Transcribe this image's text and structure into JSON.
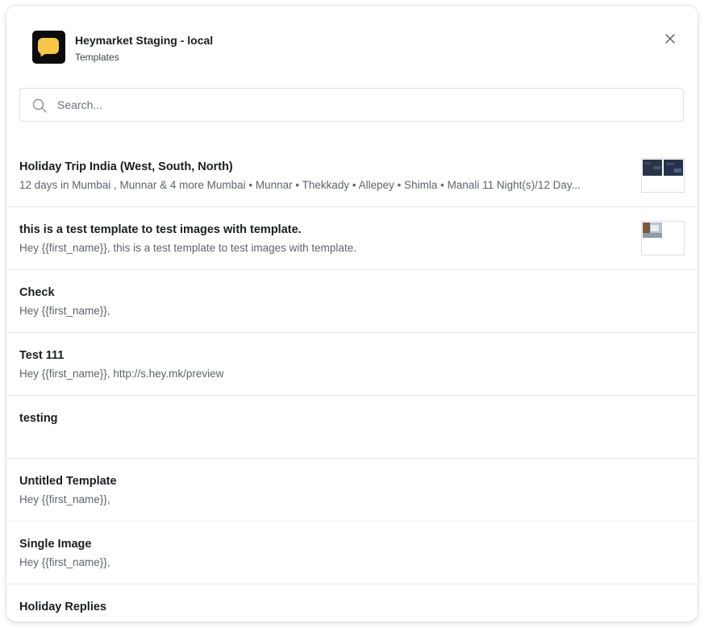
{
  "header": {
    "app_title": "Heymarket Staging - local",
    "subtitle": "Templates",
    "logo_icon": "chat-bubble-logo",
    "close_icon": "close-icon"
  },
  "search": {
    "placeholder": "Search...",
    "value": "",
    "icon": "search-icon"
  },
  "colors": {
    "logo_background": "#0c0c0c",
    "logo_bubble": "#f7c64a",
    "title_text": "#1b1d21",
    "preview_text": "#5f636b",
    "divider": "#e8eaed"
  },
  "templates": [
    {
      "title": "Holiday Trip India (West, South, North)",
      "preview": "12 days in Mumbai , Munnar & 4 more Mumbai • Munnar • Thekkady • Allepey • Shimla • Manali 11 Night(s)/12 Day...",
      "has_thumbnail": true
    },
    {
      "title": "this is a test template to test images with template.",
      "preview": "Hey {{first_name}}, this is a test template to test images with template.",
      "has_thumbnail": true
    },
    {
      "title": "Check",
      "preview": "Hey {{first_name}},",
      "has_thumbnail": false
    },
    {
      "title": "Test 111",
      "preview": "Hey {{first_name}}, http://s.hey.mk/preview",
      "has_thumbnail": false
    },
    {
      "title": "testing",
      "preview": "",
      "has_thumbnail": false
    },
    {
      "title": "Untitled Template",
      "preview": "Hey {{first_name}},",
      "has_thumbnail": false
    },
    {
      "title": "Single Image",
      "preview": "Hey {{first_name}},",
      "has_thumbnail": false
    },
    {
      "title": "Holiday Replies",
      "preview": "",
      "has_thumbnail": false
    }
  ]
}
